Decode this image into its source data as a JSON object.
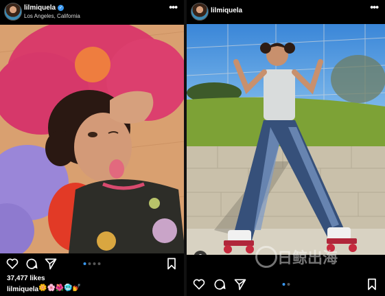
{
  "left_post": {
    "username": "lilmiquela",
    "location": "Los Angeles, California",
    "likes": "37,477 likes",
    "caption_user": "lilmiquela",
    "caption_emoji": "🌼🌸🌺🥶💅",
    "carousel": {
      "count": 4,
      "active": 0
    }
  },
  "right_post": {
    "username": "lilmiquela",
    "carousel": {
      "count": 2,
      "active": 0
    }
  },
  "icons": {
    "more": "•••",
    "verified": "✓"
  },
  "watermark_text": "日鲸出海",
  "colors": {
    "accent": "#3897f0",
    "background": "#000000"
  }
}
